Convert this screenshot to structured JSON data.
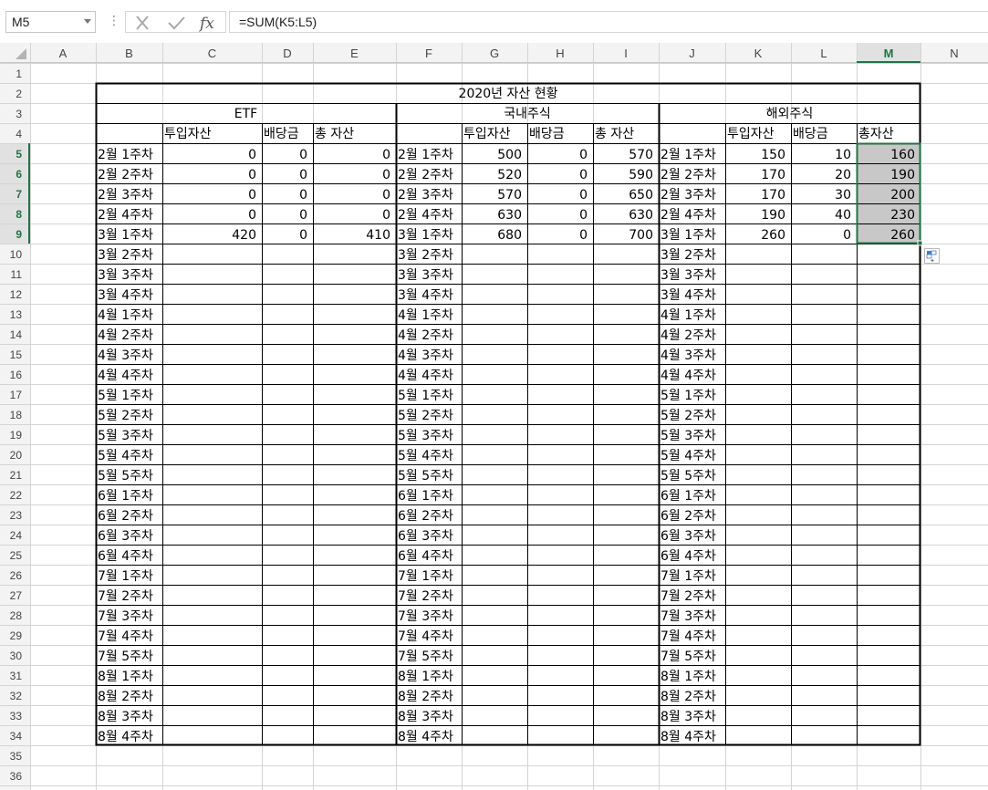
{
  "formula_bar": {
    "name_box": "M5",
    "formula": "=SUM(K5:L5)",
    "dots": "⋮",
    "cancel_icon": "close-icon",
    "enter_icon": "check-icon",
    "function_icon": "fx-icon"
  },
  "columns": [
    "A",
    "B",
    "C",
    "D",
    "E",
    "F",
    "G",
    "H",
    "I",
    "J",
    "K",
    "L",
    "M",
    "N"
  ],
  "active_column": "M",
  "rows": [
    1,
    2,
    3,
    4,
    5,
    6,
    7,
    8,
    9,
    10,
    11,
    12,
    13,
    14,
    15,
    16,
    17,
    18,
    19,
    20,
    21,
    22,
    23,
    24,
    25,
    26,
    27,
    28,
    29,
    30,
    31,
    32,
    33,
    34,
    35,
    36
  ],
  "active_rows": [
    5,
    6,
    7,
    8,
    9
  ],
  "sheet": {
    "title": "2020년 자산 현황",
    "sections": [
      "ETF",
      "국내주식",
      "해외주식"
    ],
    "etf_headers": [
      "투입자산",
      "배당금",
      "총 자산"
    ],
    "domestic_headers": [
      "투입자산",
      "배당금",
      "총 자산"
    ],
    "foreign_headers": [
      "투입자산",
      "배당금",
      "총자산"
    ],
    "weeks": [
      "2월 1주차",
      "2월 2주차",
      "2월 3주차",
      "2월 4주차",
      "3월 1주차",
      "3월 2주차",
      "3월 3주차",
      "3월 4주차",
      "4월 1주차",
      "4월 2주차",
      "4월 3주차",
      "4월 4주차",
      "5월 1주차",
      "5월 2주차",
      "5월 3주차",
      "5월 4주차",
      "5월 5주차",
      "6월 1주차",
      "6월 2주차",
      "6월 3주차",
      "6월 4주차",
      "7월 1주차",
      "7월 2주차",
      "7월 3주차",
      "7월 4주차",
      "7월 5주차",
      "8월 1주차",
      "8월 2주차",
      "8월 3주차",
      "8월 4주차"
    ],
    "etf_values": [
      [
        0,
        0,
        0
      ],
      [
        0,
        0,
        0
      ],
      [
        0,
        0,
        0
      ],
      [
        0,
        0,
        0
      ],
      [
        420,
        0,
        410
      ]
    ],
    "domestic_values": [
      [
        500,
        0,
        570
      ],
      [
        520,
        0,
        590
      ],
      [
        570,
        0,
        650
      ],
      [
        630,
        0,
        630
      ],
      [
        680,
        0,
        700
      ]
    ],
    "foreign_values": [
      [
        150,
        10,
        160
      ],
      [
        170,
        20,
        190
      ],
      [
        170,
        30,
        200
      ],
      [
        190,
        40,
        230
      ],
      [
        260,
        0,
        260
      ]
    ]
  },
  "selection": {
    "range": "M5:M9",
    "fill_color": "#c8c8c8",
    "border_color": "#217346"
  },
  "colors": {
    "gridline": "#d4d4d4",
    "header_bg": "#f3f3f3",
    "header_active_bg": "#e1e1e1",
    "header_active_text": "#217346",
    "quick_analysis_icon": "quick-analysis-icon"
  }
}
